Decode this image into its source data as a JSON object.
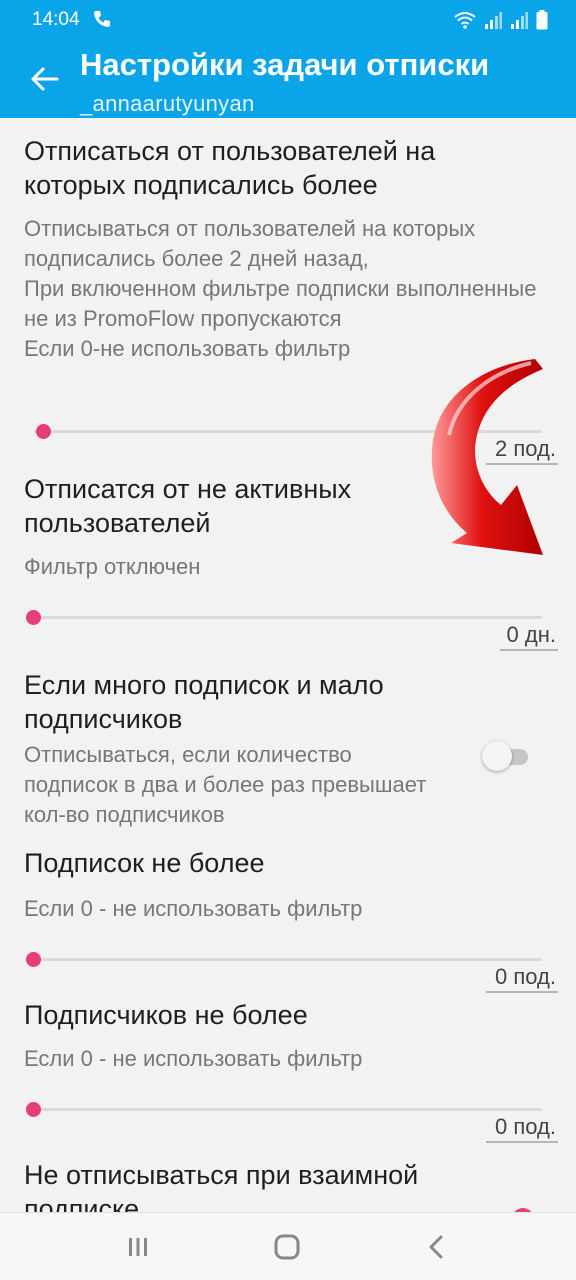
{
  "status_bar": {
    "time": "14:04",
    "icons": [
      "call-icon",
      "wifi-icon",
      "signal-icon",
      "signal-icon",
      "battery-icon"
    ]
  },
  "app_bar": {
    "title": "Настройки задачи отписки",
    "subtitle": "_annaarutyunyan",
    "color": "#0aa5e8"
  },
  "settings": [
    {
      "title": "Отписаться от пользователей на которых подписались более",
      "summary": "Отписываться от пользователей на которых подписались более 2 дней назад,\nПри включенном фильтре подписки выполненные не из PromoFlow пропускаются\nЕсли 0-не использовать фильтр",
      "type": "slider",
      "value": "2 под.",
      "level": 0.02
    },
    {
      "title": "Отписатся от не активных пользователей",
      "summary": "Фильтр отключен",
      "type": "slider",
      "value": "0 дн.",
      "level": 0
    },
    {
      "title": "Если много подписок и мало подписчиков",
      "summary": "Отписываться, если количество подписок в два и более раз превышает кол-во подписчиков",
      "type": "switch",
      "checked": false
    },
    {
      "title": "Подписок не более",
      "summary": "Если 0 - не использовать фильтр",
      "type": "slider",
      "value": "0 под.",
      "level": 0
    },
    {
      "title": "Подписчиков не более",
      "summary": "Если 0 - не использовать фильтр",
      "type": "slider",
      "value": "0 под.",
      "level": 0
    },
    {
      "title": "Не отписываться при взаимной подписке",
      "type": "switch"
    }
  ],
  "accent_color": "#e63f75",
  "nav_bar": {
    "icons": [
      "recents-icon",
      "home-icon",
      "back-icon"
    ]
  }
}
